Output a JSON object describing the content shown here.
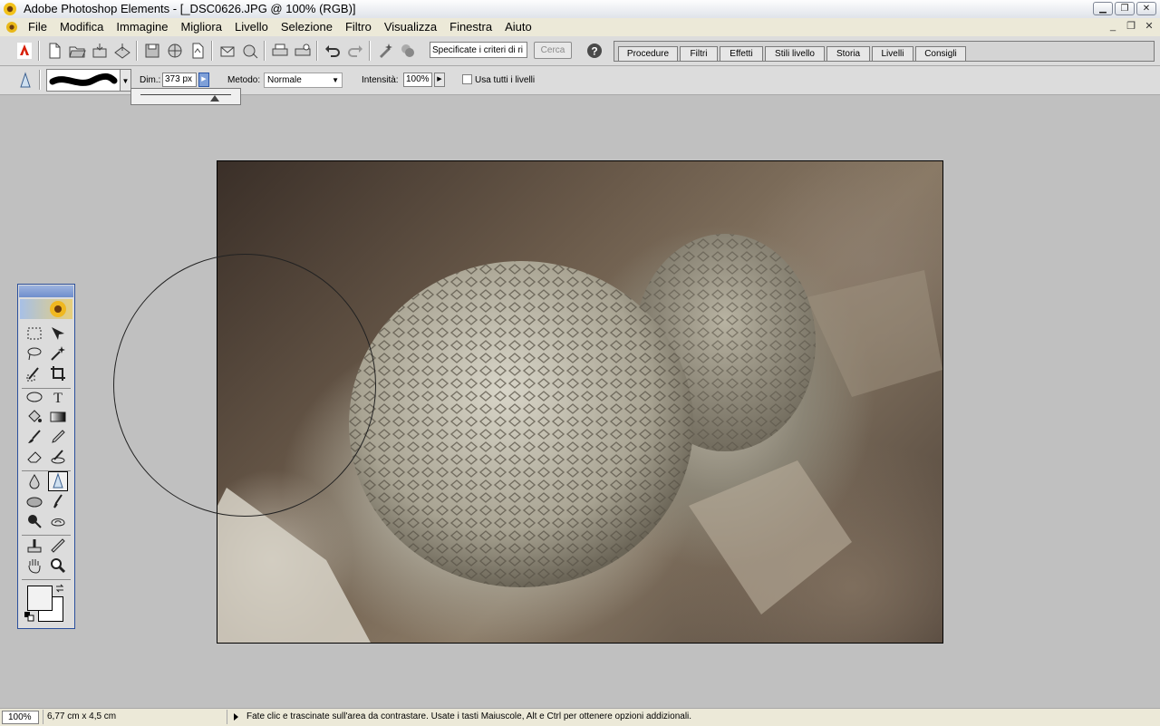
{
  "window": {
    "title": "Adobe Photoshop Elements - [_DSC0626.JPG @ 100% (RGB)]",
    "controls": [
      "minimize",
      "restore",
      "close"
    ]
  },
  "menubar": {
    "items": [
      "File",
      "Modifica",
      "Immagine",
      "Migliora",
      "Livello",
      "Selezione",
      "Filtro",
      "Visualizza",
      "Finestra",
      "Aiuto"
    ]
  },
  "shortcuts": {
    "search_value": "Specificate i criteri di ri",
    "search_button": "Cerca",
    "palette_tabs": [
      "Procedure",
      "Filtri",
      "Effetti",
      "Stili livello",
      "Storia",
      "Livelli",
      "Consigli"
    ]
  },
  "options": {
    "size_label": "Dim.:",
    "size_value": "373 px",
    "mode_label": "Metodo:",
    "mode_value": "Normale",
    "intensity_label": "Intensità:",
    "intensity_value": "100%",
    "all_layers_label": "Usa tutti i livelli",
    "all_layers_checked": false,
    "size_slider_fraction": 0.82
  },
  "statusbar": {
    "zoom": "100%",
    "dimensions": "6,77 cm x 4,5 cm",
    "hint": "Fate clic e trascinate sull'area da contrastare. Usate i tasti Maiuscole, Alt e Ctrl per ottenere opzioni addizionali."
  },
  "colors": {
    "workspace": "#c0c0c0",
    "foreground": "#f2f2f2",
    "background": "#ffffff"
  }
}
